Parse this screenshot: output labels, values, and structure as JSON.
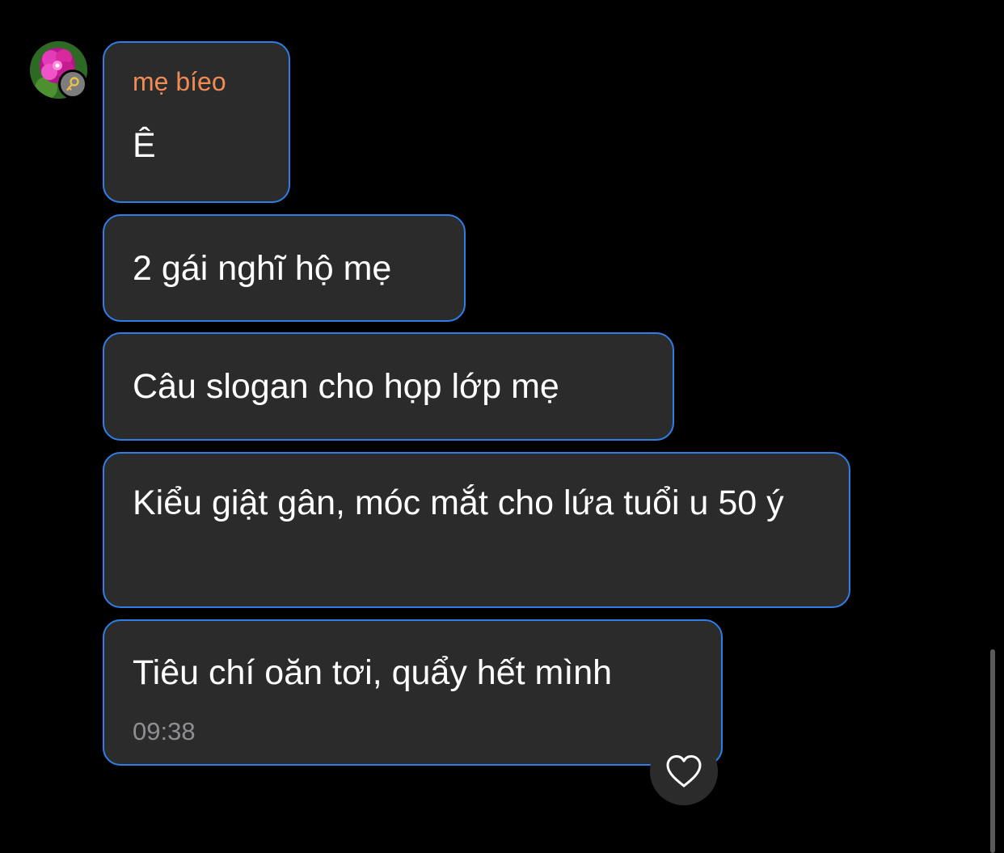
{
  "chat": {
    "sender_name": "mẹ bíeo",
    "messages": [
      {
        "text": "Ê"
      },
      {
        "text": "2 gái nghĩ hộ mẹ"
      },
      {
        "text": "Câu slogan cho họp lớp mẹ"
      },
      {
        "text": "Kiểu giật gân, móc mắt cho lứa tuổi u 50 ý"
      },
      {
        "text": "Tiêu chí oăn tơi, quẩy hết mình",
        "time": "09:38"
      }
    ]
  },
  "icons": {
    "avatar_badge": "key-icon",
    "reaction": "heart-icon"
  },
  "colors": {
    "background": "#000000",
    "bubble": "#2b2b2b",
    "bubble_border": "#2f7ee6",
    "sender_name": "#f08b55",
    "timestamp": "#8e8e93"
  }
}
